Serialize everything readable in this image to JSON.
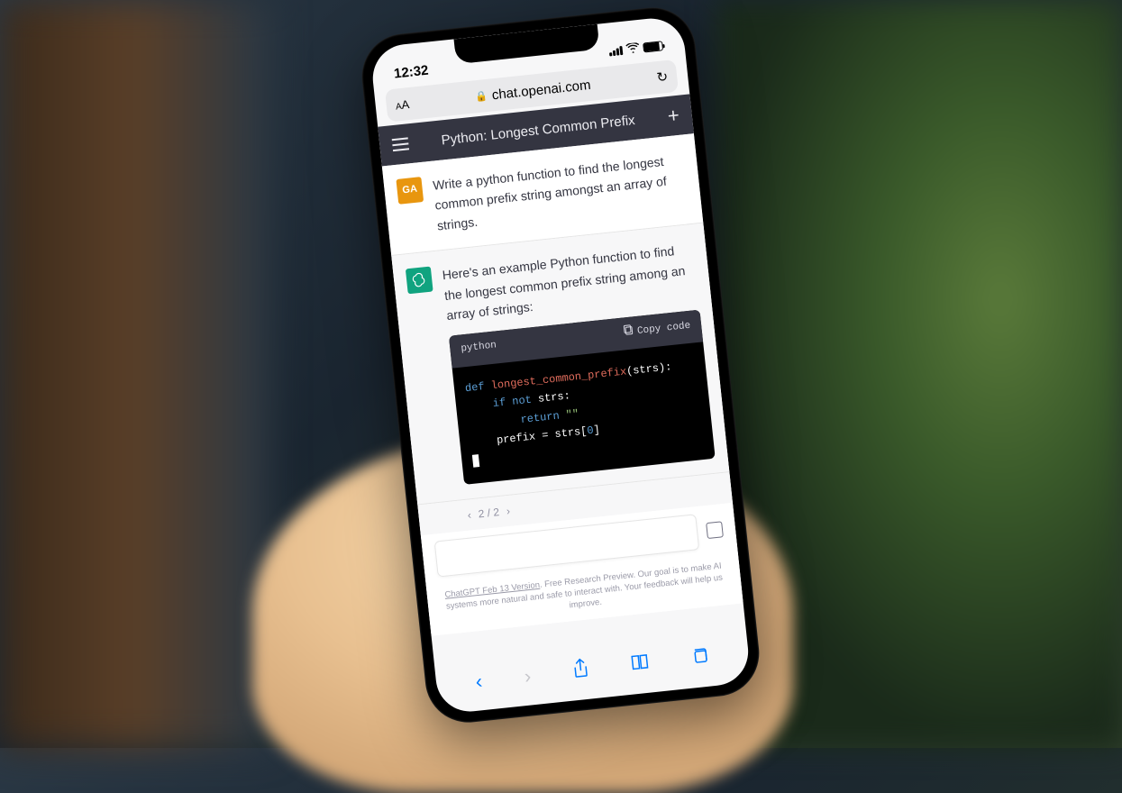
{
  "status": {
    "time": "12:32"
  },
  "browser": {
    "text_size_label": "AA",
    "url": "chat.openai.com",
    "refresh_icon": "↻"
  },
  "chat": {
    "title": "Python: Longest Common Prefix",
    "user_avatar": "GA",
    "user_message": "Write a python function to find the longest common prefix string amongst an array of strings.",
    "assistant_intro": "Here's an example Python function to find the longest common prefix string among an array of strings:",
    "code": {
      "language": "python",
      "copy_label": "Copy code",
      "line1_kw": "def",
      "line1_fn": "longest_common_prefix",
      "line1_rest": "(strs):",
      "line2_kw": "if not",
      "line2_rest": " strs:",
      "line3_kw": "return",
      "line3_str": " \"\"",
      "line4_a": "prefix = strs[",
      "line4_num": "0",
      "line4_b": "]"
    },
    "pagination": {
      "prev": "‹",
      "label": "2 / 2",
      "next": "›"
    }
  },
  "footer": {
    "version_link": "ChatGPT Feb 13 Version",
    "disclaimer": ". Free Research Preview. Our goal is to make AI systems more natural and safe to interact with. Your feedback will help us improve."
  }
}
